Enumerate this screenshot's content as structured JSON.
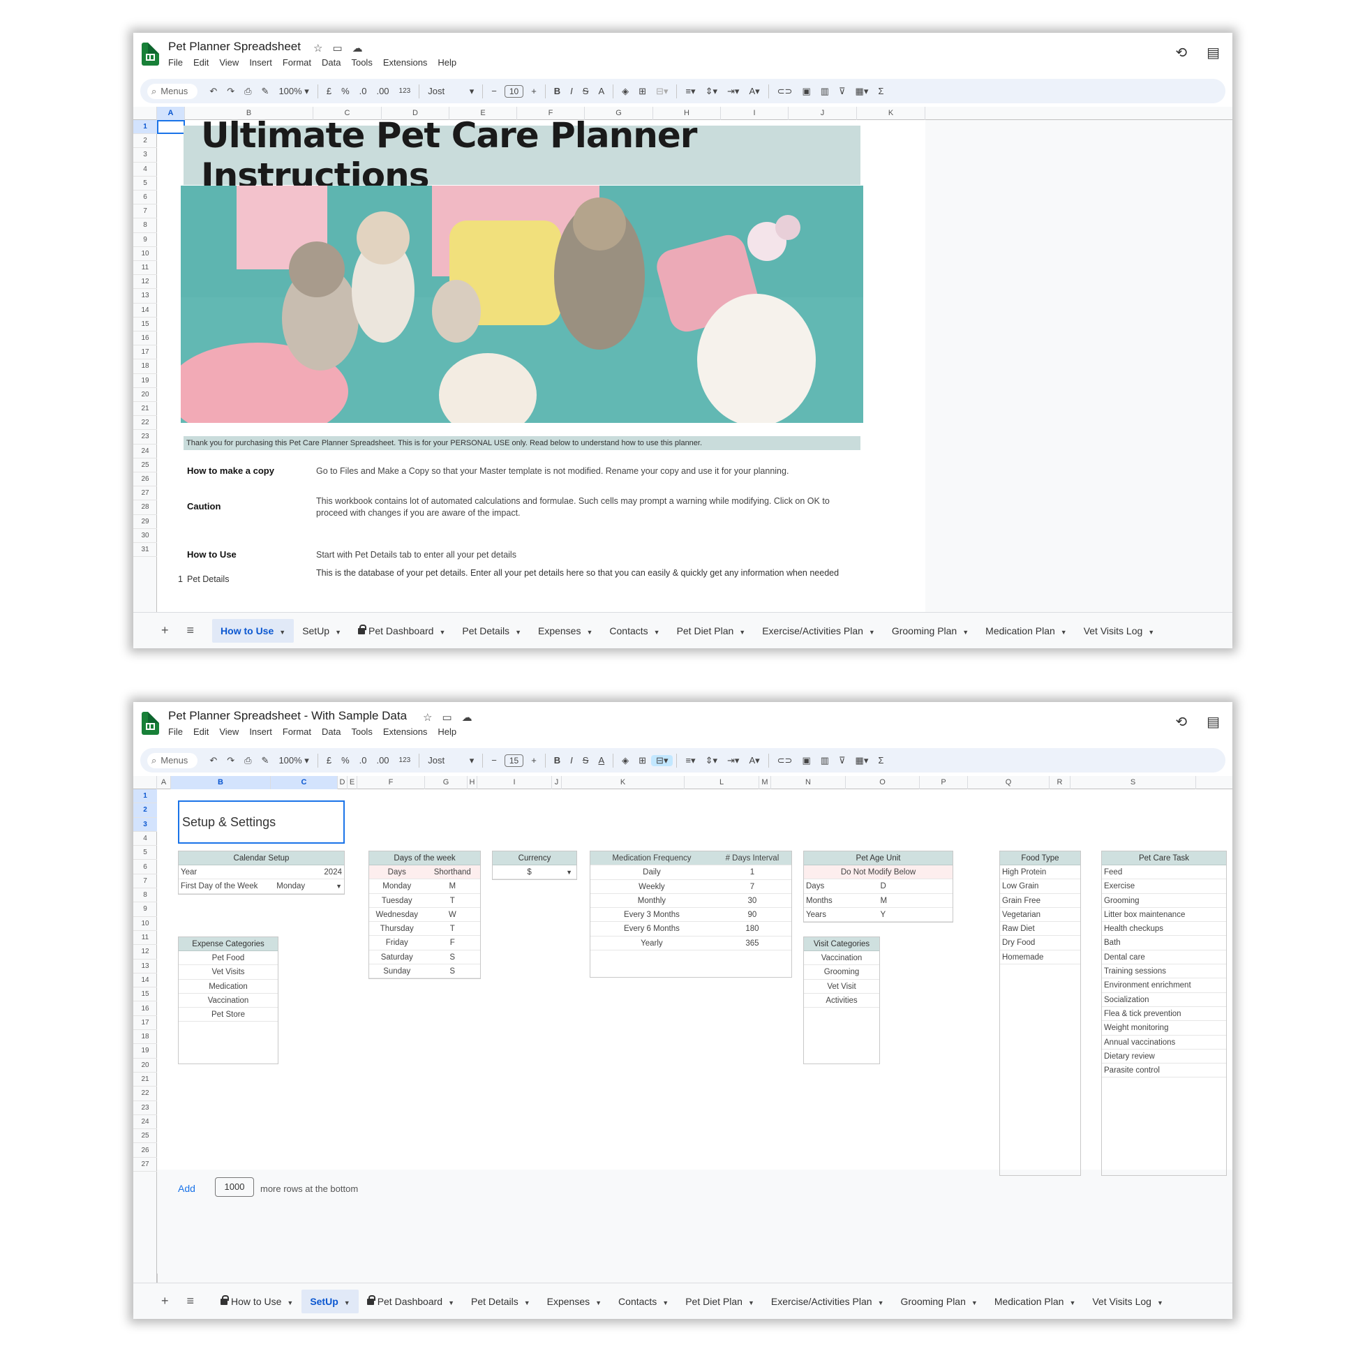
{
  "menu_items": [
    "File",
    "Edit",
    "View",
    "Insert",
    "Format",
    "Data",
    "Tools",
    "Extensions",
    "Help"
  ],
  "window1": {
    "doc_title": "Pet Planner Spreadsheet",
    "toolbar": {
      "menus": "Menus",
      "zoom": "100%",
      "currency": "£",
      "percent": "%",
      "dec_less": ".0",
      "dec_more": ".00",
      "numfmt": "123",
      "font": "Jost",
      "font_size": "10"
    },
    "columns": [
      "A",
      "B",
      "C",
      "D",
      "E",
      "F",
      "G",
      "H",
      "I",
      "J",
      "K"
    ],
    "rows": [
      "1",
      "2",
      "3",
      "4",
      "5",
      "6",
      "7",
      "8",
      "9",
      "10",
      "11",
      "12",
      "13",
      "14",
      "15",
      "16",
      "17",
      "18",
      "19",
      "20",
      "21",
      "22",
      "23",
      "24",
      "25",
      "26",
      "27",
      "28",
      "29",
      "30",
      "31"
    ],
    "banner_title": "Ultimate Pet Care Planner Instructions",
    "thanks_text": "Thank you for purchasing this Pet Care Planner Spreadsheet. This is for your PERSONAL USE only. Read below to understand how to use this planner.",
    "instructions": [
      {
        "label": "How to make a copy",
        "text": "Go to Files and Make a Copy so that your Master template is not modified. Rename your copy and use it for your planning."
      },
      {
        "label": "Caution",
        "text": "This workbook contains lot of automated calculations and formulae. Such cells may prompt a warning while modifying. Click on OK to proceed with changes if you are aware of the impact."
      },
      {
        "label": "How to Use",
        "text": "Start with Pet Details tab to enter all your pet details"
      }
    ],
    "pet_details_row": {
      "num": "1",
      "label": "Pet Details",
      "text": "This is the database of your pet details. Enter all your pet details here so that you can easily & quickly get any information when needed"
    },
    "tabs": [
      "How to Use",
      "SetUp",
      "Pet Dashboard",
      "Pet Details",
      "Expenses",
      "Contacts",
      "Pet Diet Plan",
      "Exercise/Activities Plan",
      "Grooming Plan",
      "Medication Plan",
      "Vet Visits Log"
    ]
  },
  "window2": {
    "doc_title": "Pet Planner Spreadsheet - With Sample Data",
    "toolbar": {
      "menus": "Menus",
      "zoom": "100%",
      "currency": "£",
      "percent": "%",
      "dec_less": ".0",
      "dec_more": ".00",
      "numfmt": "123",
      "font": "Jost",
      "font_size": "15"
    },
    "columns": [
      "A",
      "B",
      "C",
      "D",
      "E",
      "F",
      "G",
      "H",
      "I",
      "J",
      "K",
      "L",
      "M",
      "N",
      "O",
      "P",
      "Q",
      "R",
      "S"
    ],
    "rows": [
      "1",
      "2",
      "3",
      "4",
      "5",
      "6",
      "7",
      "8",
      "9",
      "10",
      "11",
      "12",
      "13",
      "14",
      "15",
      "16",
      "17",
      "18",
      "19",
      "20",
      "21",
      "22",
      "23",
      "24",
      "25",
      "26",
      "27"
    ],
    "setup_title": "Setup & Settings",
    "calendar_setup": {
      "header": "Calendar Setup",
      "rows": [
        [
          "Year",
          "2024"
        ],
        [
          "First Day of the Week",
          "Monday"
        ]
      ]
    },
    "days_of_week": {
      "header": "Days of the week",
      "subheader": [
        "Days",
        "Shorthand"
      ],
      "rows": [
        [
          "Monday",
          "M"
        ],
        [
          "Tuesday",
          "T"
        ],
        [
          "Wednesday",
          "W"
        ],
        [
          "Thursday",
          "T"
        ],
        [
          "Friday",
          "F"
        ],
        [
          "Saturday",
          "S"
        ],
        [
          "Sunday",
          "S"
        ]
      ]
    },
    "currency": {
      "header": "Currency",
      "value": "$"
    },
    "medication_frequency": {
      "header": "Medication Frequency",
      "header2": "# Days Interval",
      "rows": [
        [
          "Daily",
          "1"
        ],
        [
          "Weekly",
          "7"
        ],
        [
          "Monthly",
          "30"
        ],
        [
          "Every 3 Months",
          "90"
        ],
        [
          "Every 6 Months",
          "180"
        ],
        [
          "Yearly",
          "365"
        ]
      ]
    },
    "pet_age_unit": {
      "header": "Pet Age Unit",
      "subheader": "Do Not Modify Below",
      "rows": [
        [
          "Days",
          "D"
        ],
        [
          "Months",
          "M"
        ],
        [
          "Years",
          "Y"
        ]
      ]
    },
    "expense_categories": {
      "header": "Expense Categories",
      "rows": [
        "Pet Food",
        "Vet Visits",
        "Medication",
        "Vaccination",
        "Pet Store"
      ]
    },
    "visit_categories": {
      "header": "Visit Categories",
      "rows": [
        "Vaccination",
        "Grooming",
        "Vet Visit",
        "Activities"
      ]
    },
    "food_type": {
      "header": "Food Type",
      "rows": [
        "High Protein",
        "Low Grain",
        "Grain Free",
        "Vegetarian",
        "Raw Diet",
        "Dry Food",
        "Homemade"
      ]
    },
    "pet_care_task": {
      "header": "Pet Care Task",
      "rows": [
        "Feed",
        "Exercise",
        "Grooming",
        "Litter box maintenance",
        "Health checkups",
        "Bath",
        "Dental care",
        "Training sessions",
        "Environment enrichment",
        "Socialization",
        "Flea & tick prevention",
        "Weight monitoring",
        "Annual vaccinations",
        "Dietary review",
        "Parasite control"
      ]
    },
    "add_rows": {
      "add_label": "Add",
      "count": "1000",
      "suffix": "more rows at the bottom"
    },
    "tabs": [
      "How to Use",
      "SetUp",
      "Pet Dashboard",
      "Pet Details",
      "Expenses",
      "Contacts",
      "Pet Diet Plan",
      "Exercise/Activities Plan",
      "Grooming Plan",
      "Medication Plan",
      "Vet Visits Log"
    ]
  }
}
